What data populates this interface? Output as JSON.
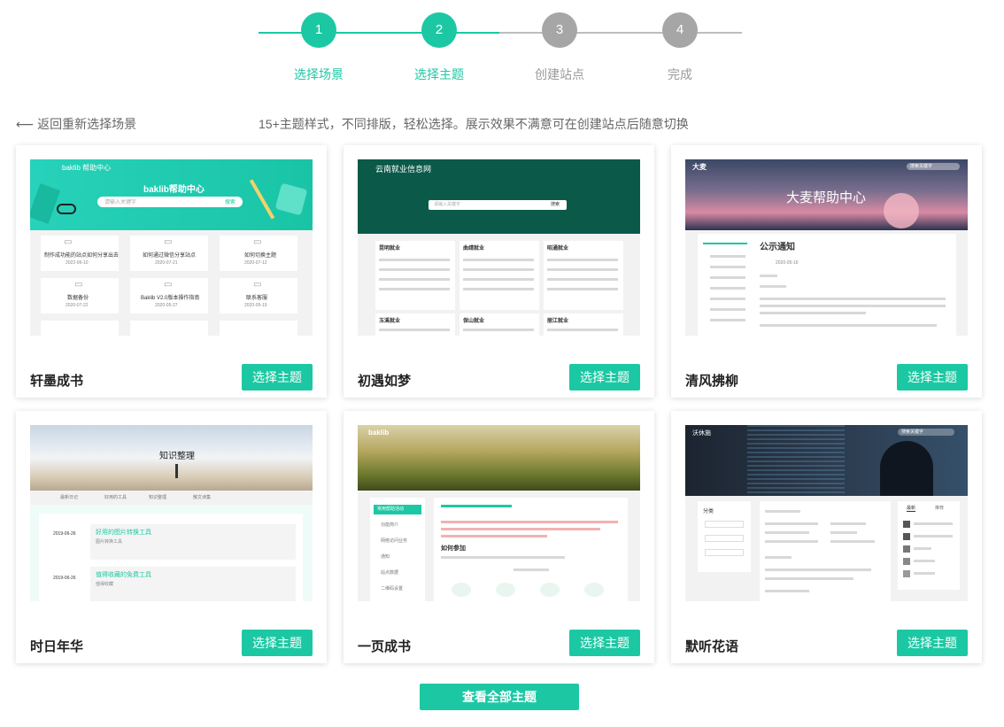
{
  "stepper": {
    "steps": [
      {
        "num": "1",
        "label": "选择场景",
        "state": "active"
      },
      {
        "num": "2",
        "label": "选择主题",
        "state": "active"
      },
      {
        "num": "3",
        "label": "创建站点",
        "state": "inactive"
      },
      {
        "num": "4",
        "label": "完成",
        "state": "inactive"
      }
    ]
  },
  "back_link": "返回重新选择场景",
  "hint": "15+主题样式，不同排版，轻松选择。展示效果不满意可在创建站点后随意切换",
  "choose_label": "选择主题",
  "view_all_label": "查看全部主题",
  "themes": [
    {
      "name": "轩墨成书",
      "preview": {
        "logo": "baklib 帮助中心",
        "hero_title": "baklib帮助中心",
        "search_placeholder": "请输入关键字",
        "search_btn": "搜索",
        "cards": [
          {
            "title": "制作成功能的站点如何分享出去",
            "date": "2022-06-10"
          },
          {
            "title": "如何通过微信分享站点",
            "date": "2020-07-21"
          },
          {
            "title": "如何切换主题",
            "date": "2020-07-12"
          },
          {
            "title": "数据备份",
            "date": "2020-07-22"
          },
          {
            "title": "Baklib V2.0版本操作指南",
            "date": "2020-05-27"
          },
          {
            "title": "联系客服",
            "date": "2020-05-19"
          }
        ]
      }
    },
    {
      "name": "初遇如梦",
      "preview": {
        "logo": "云南就业信息网",
        "search_placeholder": "请输入关键字",
        "search_btn": "搜索",
        "columns": [
          "昆明就业",
          "曲靖就业",
          "昭通就业",
          "玉溪就业",
          "保山就业",
          "丽江就业"
        ]
      }
    },
    {
      "name": "清风拂柳",
      "preview": {
        "hero_title": "大麦帮助中心",
        "logo": "大麦",
        "search_placeholder": "搜索关键字",
        "article_title": "公示通知",
        "date": "2020-05-16"
      }
    },
    {
      "name": "时日年华",
      "preview": {
        "hero_title": "知识整理",
        "nav": [
          "最新日记",
          "好用的工具",
          "知识整理",
          "散文诗集"
        ],
        "posts": [
          {
            "date": "2019-06-26",
            "title": "好用的图片转换工具",
            "desc": "图片转换工具"
          },
          {
            "date": "2019-06-26",
            "title": "值得收藏的免费工具",
            "desc": "值得收藏"
          }
        ]
      }
    },
    {
      "name": "一页成书",
      "preview": {
        "logo": "baklib",
        "sidebar": [
          "常用帮助活动",
          "功能简介",
          "网络访问业务",
          "通知",
          "站点数据",
          "二维码设置"
        ],
        "heading": "如何参加"
      }
    },
    {
      "name": "默听花语",
      "preview": {
        "logo": "沃休施",
        "search_placeholder": "搜索关键字",
        "sidebar_title": "分类",
        "tabs": [
          "最新",
          "推荐"
        ]
      }
    }
  ],
  "colors": {
    "accent": "#1cc8a3",
    "inactive": "#a6a6a6"
  }
}
